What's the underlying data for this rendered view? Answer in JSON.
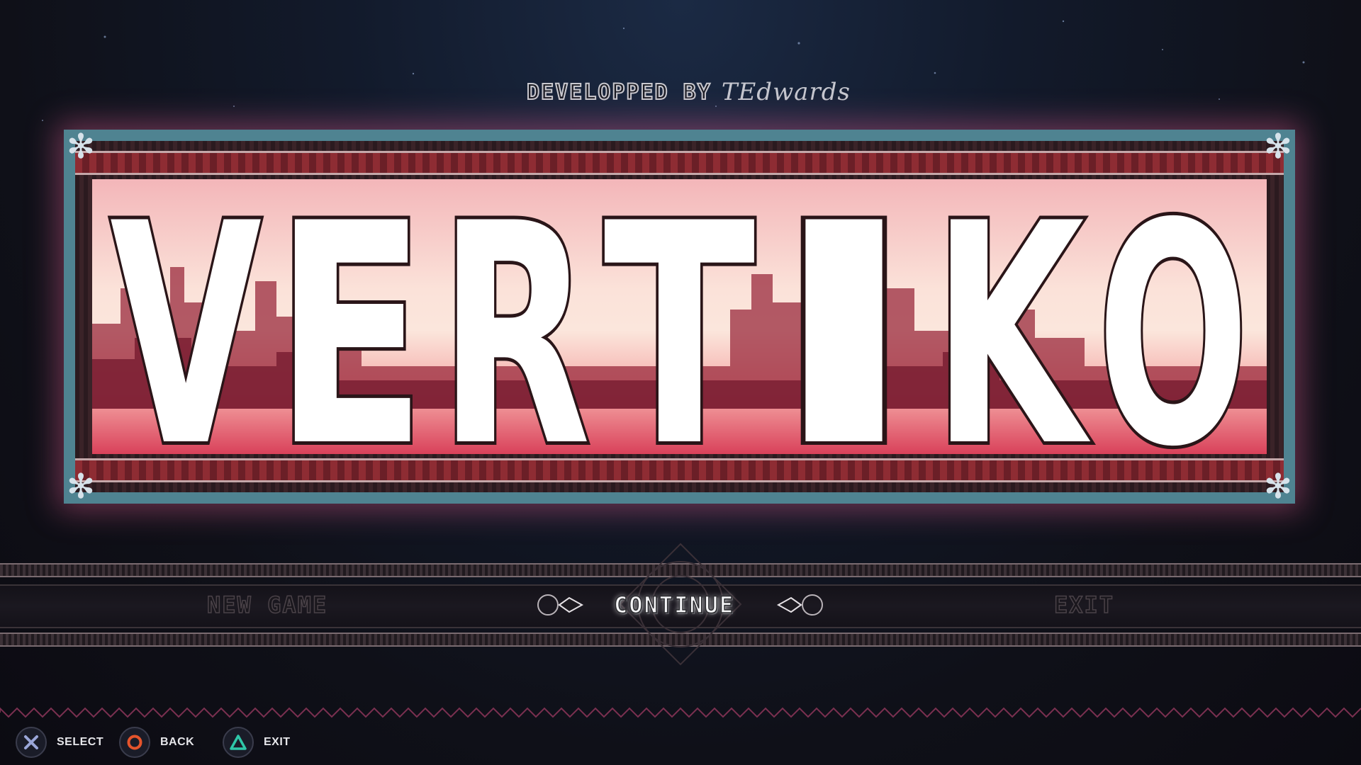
{
  "credit": {
    "label": "DEVELOPPED BY",
    "signature": "TEdwards"
  },
  "logo": {
    "letters": [
      "V",
      "E",
      "R",
      "T",
      "I",
      "K",
      "O"
    ],
    "title": "VERTIKO"
  },
  "menu": {
    "items": [
      {
        "label": "NEW GAME",
        "selected": false
      },
      {
        "label": "CONTINUE",
        "selected": true
      },
      {
        "label": "EXIT",
        "selected": false
      }
    ]
  },
  "hints": [
    {
      "icon": "cross-button-icon",
      "label": "SELECT",
      "color": "#9aa6d8"
    },
    {
      "icon": "circle-button-icon",
      "label": "BACK",
      "color": "#e5542c"
    },
    {
      "icon": "triangle-button-icon",
      "label": "EXIT",
      "color": "#2fc7a8"
    }
  ],
  "colors": {
    "accent": "#d65a8c",
    "frame": "#4f8391",
    "logo_fill": "#ffffff",
    "logo_stripe": "#8b5a5c"
  }
}
